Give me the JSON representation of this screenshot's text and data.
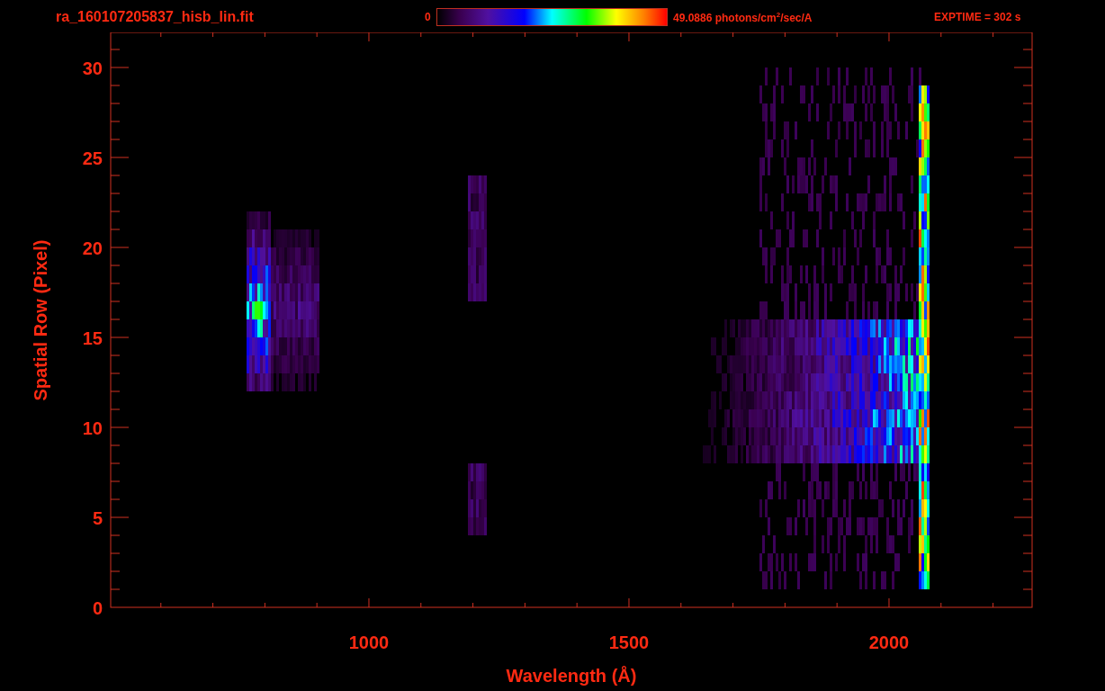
{
  "header": {
    "filename": "ra_160107205837_hisb_lin.fit",
    "colorbar": {
      "min_label": "0",
      "max_label": "49.0886 photons/cm$^{2}$/sec/A"
    },
    "exptime": "EXPTIME = 302 s"
  },
  "plot": {
    "xlabel": "Wavelength (Å)",
    "ylabel": "Spatial Row (Pixel)",
    "xticks": [
      "1000",
      "1500",
      "2000"
    ],
    "yticks": [
      "30",
      "25",
      "20",
      "15",
      "10",
      "5",
      "0"
    ]
  }
}
